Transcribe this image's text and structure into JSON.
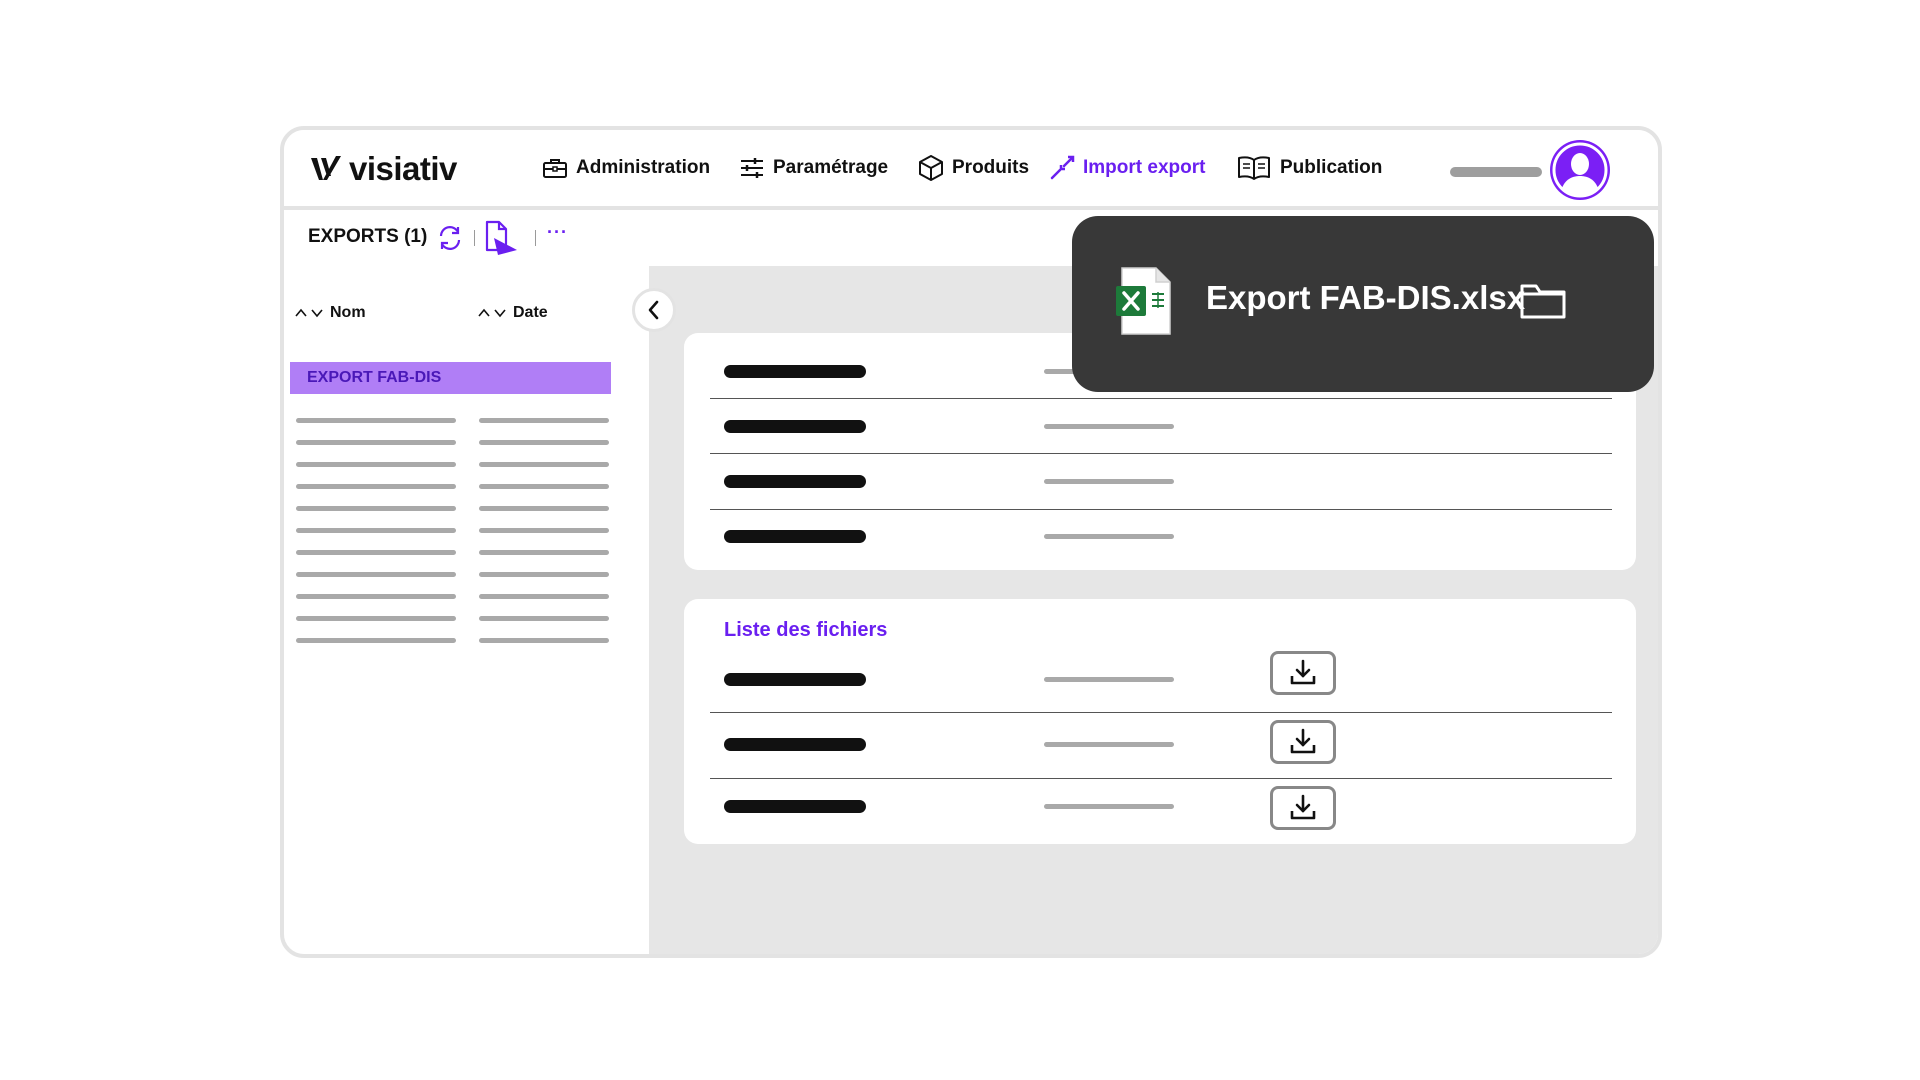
{
  "app": {
    "logo_text": "visiativ"
  },
  "nav": {
    "items": [
      {
        "label": "Administration",
        "icon": "briefcase-icon"
      },
      {
        "label": "Paramétrage",
        "icon": "sliders-icon"
      },
      {
        "label": "Produits",
        "icon": "cube-icon"
      },
      {
        "label": "Import export",
        "icon": "import-export-icon",
        "active": true
      },
      {
        "label": "Publication",
        "icon": "book-icon"
      }
    ],
    "accent_color": "#6a1ff0",
    "avatar_color": "#7b1ff5"
  },
  "toolbar": {
    "title": "EXPORTS (1)",
    "more_label": "···"
  },
  "list": {
    "columns": [
      "Nom",
      "Date"
    ],
    "selected_item": "EXPORT FAB-DIS",
    "selected_color": "#b07ef6"
  },
  "files_card": {
    "title": "Liste des fichiers"
  },
  "toast": {
    "file_name": "Export FAB-DIS.xlsx",
    "file_icon": "excel-file-icon",
    "action_icon": "folder-icon"
  }
}
